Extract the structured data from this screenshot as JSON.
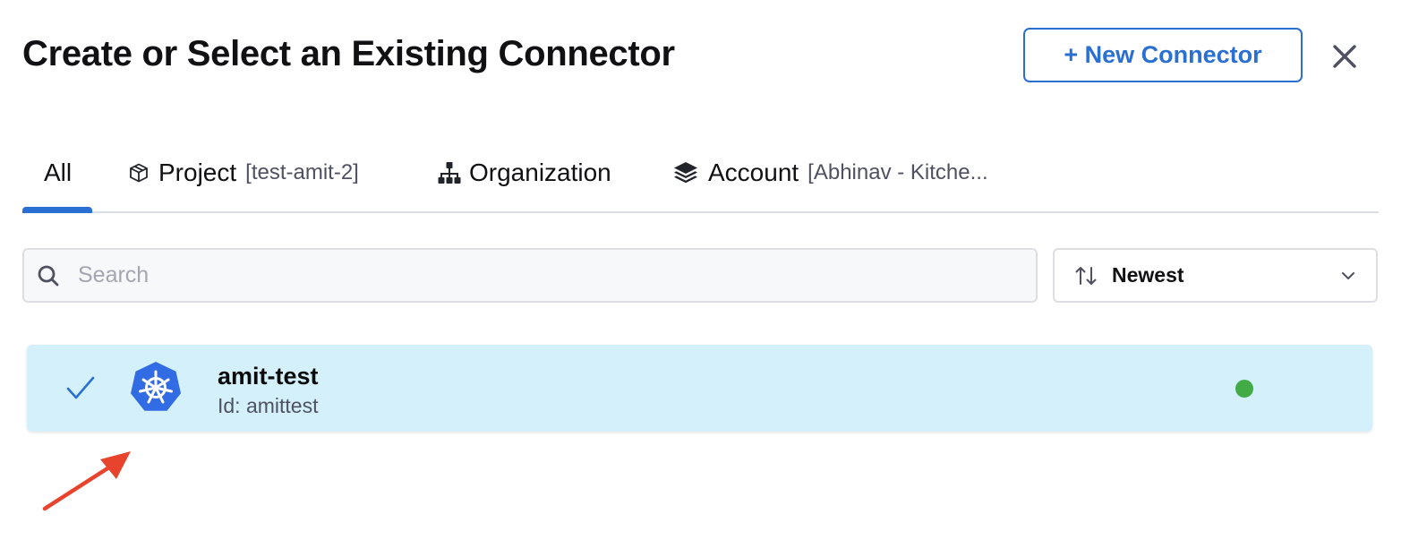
{
  "dialog": {
    "title": "Create or Select an Existing Connector",
    "new_connector_label": "+ New Connector",
    "close_icon": "close-icon"
  },
  "tabs": [
    {
      "label": "All",
      "scope": "",
      "icon": "",
      "selected": true
    },
    {
      "label": "Project",
      "scope": "[test-amit-2]",
      "icon": "cube-icon",
      "selected": false
    },
    {
      "label": "Organization",
      "scope": "",
      "icon": "org-chart-icon",
      "selected": false
    },
    {
      "label": "Account",
      "scope": "[Abhinav - Kitche...",
      "icon": "layers-icon",
      "selected": false
    }
  ],
  "search": {
    "placeholder": "Search",
    "value": "",
    "icon": "search-icon"
  },
  "sort": {
    "label": "Newest",
    "icon": "sort-arrows-icon"
  },
  "connectors": [
    {
      "name": "amit-test",
      "id_text": "Id: amittest",
      "selected": true,
      "logo": "kubernetes-icon",
      "status_color": "#42ab45"
    }
  ],
  "colors": {
    "accent": "#2a6fd2",
    "selected_row": "#d4f1fb",
    "status_ok": "#42ab45",
    "annotation_arrow": "#e8432c"
  }
}
